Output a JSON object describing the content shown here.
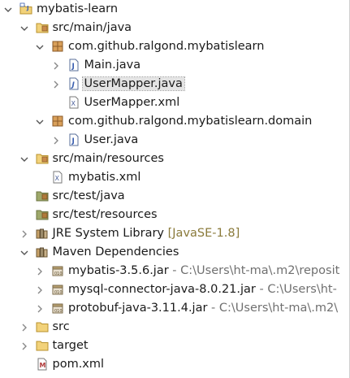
{
  "tree": [
    {
      "name": "node-project",
      "label": "mybatis-learn",
      "depth": 0,
      "expand": "open",
      "icon": "java-project-icon"
    },
    {
      "name": "node-src-main-java",
      "label": "src/main/java",
      "depth": 1,
      "expand": "open",
      "icon": "source-folder-icon"
    },
    {
      "name": "node-pkg-mybatislearn",
      "label": "com.github.ralgond.mybatislearn",
      "depth": 2,
      "expand": "open",
      "icon": "package-icon"
    },
    {
      "name": "node-main-java",
      "label": "Main.java",
      "depth": 3,
      "expand": "closed",
      "icon": "java-file-icon"
    },
    {
      "name": "node-usermapper-java",
      "label": "UserMapper.java",
      "depth": 3,
      "expand": "closed",
      "icon": "java-interface-file-icon",
      "selected": true
    },
    {
      "name": "node-usermapper-xml",
      "label": "UserMapper.xml",
      "depth": 3,
      "expand": "none",
      "icon": "xml-file-icon"
    },
    {
      "name": "node-pkg-domain",
      "label": "com.github.ralgond.mybatislearn.domain",
      "depth": 2,
      "expand": "open",
      "icon": "package-icon"
    },
    {
      "name": "node-user-java",
      "label": "User.java",
      "depth": 3,
      "expand": "closed",
      "icon": "java-file-icon"
    },
    {
      "name": "node-src-main-resources",
      "label": "src/main/resources",
      "depth": 1,
      "expand": "open",
      "icon": "source-folder-icon"
    },
    {
      "name": "node-mybatis-xml",
      "label": "mybatis.xml",
      "depth": 2,
      "expand": "none",
      "icon": "xml-file-icon"
    },
    {
      "name": "node-src-test-java",
      "label": "src/test/java",
      "depth": 1,
      "expand": "none",
      "icon": "source-folder-empty-icon"
    },
    {
      "name": "node-src-test-resources",
      "label": "src/test/resources",
      "depth": 1,
      "expand": "none",
      "icon": "source-folder-empty-icon"
    },
    {
      "name": "node-jre-library",
      "label": "JRE System Library",
      "decoration": "[JavaSE-1.8]",
      "depth": 1,
      "expand": "closed",
      "icon": "library-icon"
    },
    {
      "name": "node-maven-deps",
      "label": "Maven Dependencies",
      "depth": 1,
      "expand": "open",
      "icon": "library-icon"
    },
    {
      "name": "node-jar-mybatis",
      "label": "mybatis-3.5.6.jar",
      "path": "- C:\\Users\\ht-ma\\.m2\\reposit",
      "depth": 2,
      "expand": "closed",
      "icon": "jar-icon"
    },
    {
      "name": "node-jar-mysql",
      "label": "mysql-connector-java-8.0.21.jar",
      "path": "- C:\\Users\\ht-",
      "depth": 2,
      "expand": "closed",
      "icon": "jar-icon"
    },
    {
      "name": "node-jar-protobuf",
      "label": "protobuf-java-3.11.4.jar",
      "path": "- C:\\Users\\ht-ma\\.m2\\",
      "depth": 2,
      "expand": "closed",
      "icon": "jar-icon"
    },
    {
      "name": "node-src",
      "label": "src",
      "depth": 1,
      "expand": "closed",
      "icon": "folder-icon"
    },
    {
      "name": "node-target",
      "label": "target",
      "depth": 1,
      "expand": "closed",
      "icon": "folder-icon"
    },
    {
      "name": "node-pom-xml",
      "label": "pom.xml",
      "depth": 1,
      "expand": "none",
      "icon": "maven-pom-file-icon"
    }
  ],
  "colors": {
    "selection": "#e4e4e4",
    "decoration": "#8a7a3a",
    "path": "#707070",
    "folder": "#e8c46a",
    "package": "#b07a3a",
    "java_file": "#3a5fb0"
  }
}
